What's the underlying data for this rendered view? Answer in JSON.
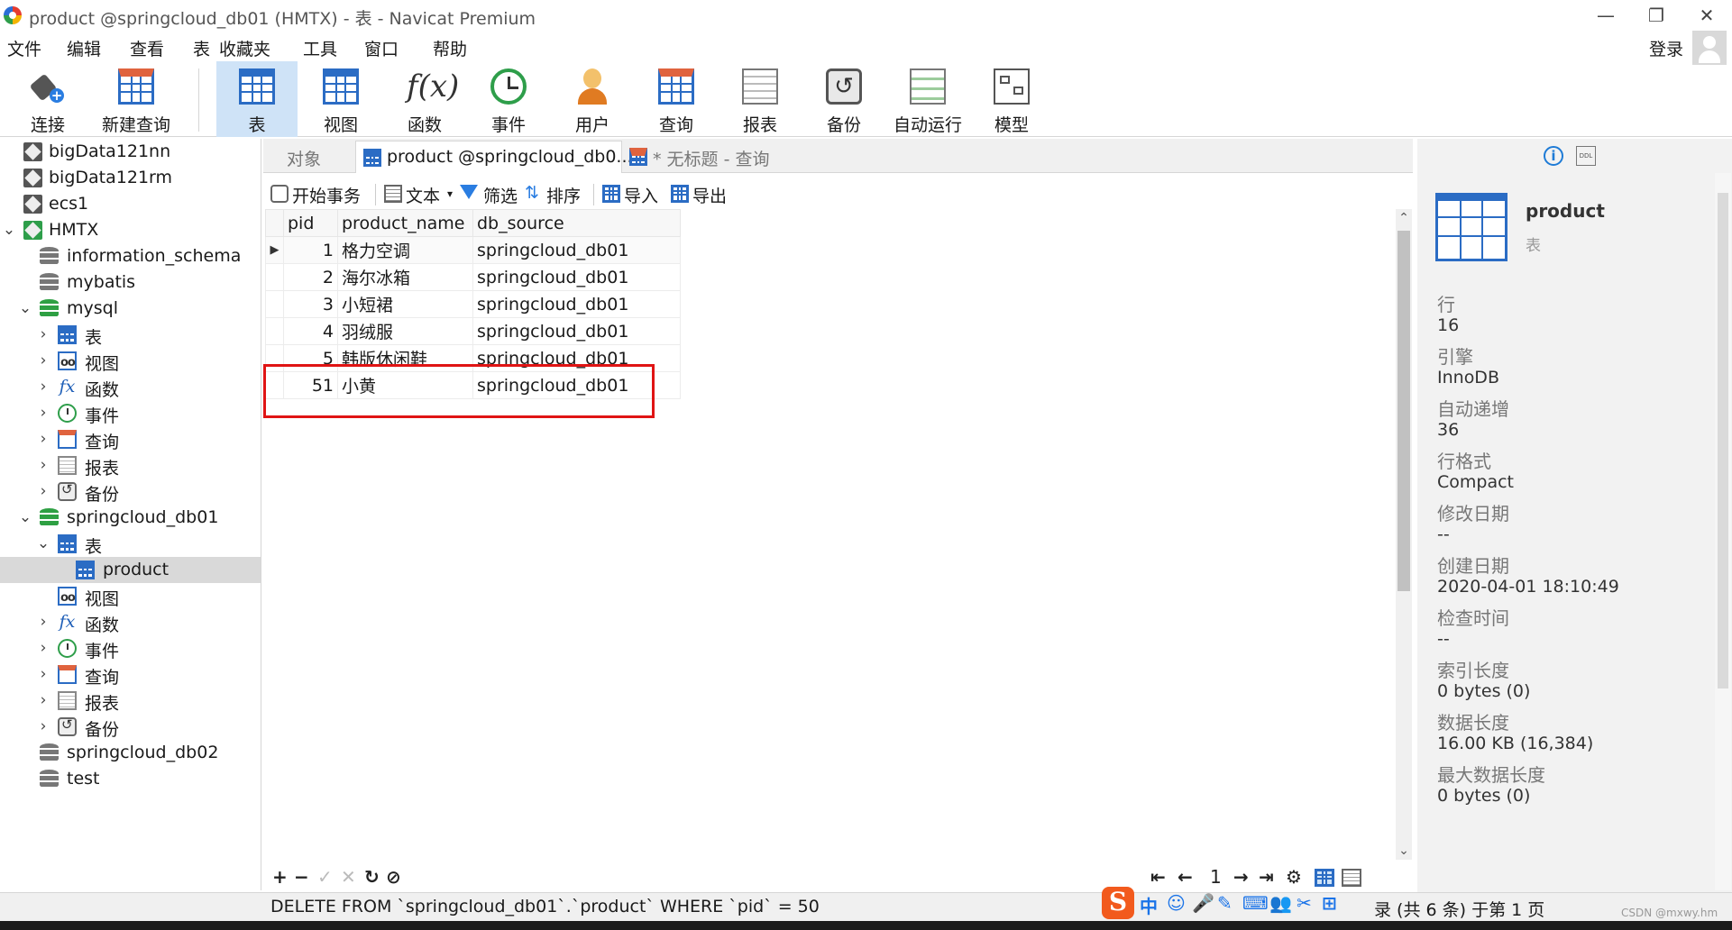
{
  "window": {
    "title": "product @springcloud_db01 (HMTX) - 表 - Navicat Premium",
    "controls": [
      "—",
      "❐",
      "✕"
    ]
  },
  "menu": [
    "文件",
    "编辑",
    "查看",
    "表",
    "收藏夹",
    "工具",
    "窗口",
    "帮助"
  ],
  "login_label": "登录",
  "toolbar": [
    {
      "label": "连接",
      "icon": "connect-icon"
    },
    {
      "label": "新建查询",
      "icon": "new-query-icon"
    },
    {
      "label": "表",
      "icon": "table-icon",
      "active": true
    },
    {
      "label": "视图",
      "icon": "view-icon"
    },
    {
      "label": "函数",
      "icon": "function-icon"
    },
    {
      "label": "事件",
      "icon": "event-icon"
    },
    {
      "label": "用户",
      "icon": "user-icon"
    },
    {
      "label": "查询",
      "icon": "query-icon"
    },
    {
      "label": "报表",
      "icon": "report-icon"
    },
    {
      "label": "备份",
      "icon": "backup-icon"
    },
    {
      "label": "自动运行",
      "icon": "automation-icon"
    },
    {
      "label": "模型",
      "icon": "model-icon"
    }
  ],
  "tree": [
    {
      "label": "bigData121nn",
      "level": 0,
      "icon": "connection"
    },
    {
      "label": "bigData121rm",
      "level": 0,
      "icon": "connection"
    },
    {
      "label": "ecs1",
      "level": 0,
      "icon": "connection"
    },
    {
      "label": "HMTX",
      "level": 0,
      "icon": "connection-open",
      "arrow": "down"
    },
    {
      "label": "information_schema",
      "level": 1,
      "icon": "database"
    },
    {
      "label": "mybatis",
      "level": 1,
      "icon": "database"
    },
    {
      "label": "mysql",
      "level": 1,
      "icon": "database-open",
      "arrow": "down"
    },
    {
      "label": "表",
      "level": 2,
      "icon": "table",
      "arrow": "right"
    },
    {
      "label": "视图",
      "level": 2,
      "icon": "view",
      "arrow": "right"
    },
    {
      "label": "函数",
      "level": 2,
      "icon": "function",
      "arrow": "right"
    },
    {
      "label": "事件",
      "level": 2,
      "icon": "event",
      "arrow": "right"
    },
    {
      "label": "查询",
      "level": 2,
      "icon": "query",
      "arrow": "right"
    },
    {
      "label": "报表",
      "level": 2,
      "icon": "report",
      "arrow": "right"
    },
    {
      "label": "备份",
      "level": 2,
      "icon": "backup",
      "arrow": "right"
    },
    {
      "label": "springcloud_db01",
      "level": 1,
      "icon": "database-open",
      "arrow": "down"
    },
    {
      "label": "表",
      "level": 2,
      "icon": "table",
      "arrow": "down"
    },
    {
      "label": "product",
      "level": 3,
      "icon": "table",
      "selected": true
    },
    {
      "label": "视图",
      "level": 2,
      "icon": "view"
    },
    {
      "label": "函数",
      "level": 2,
      "icon": "function",
      "arrow": "right"
    },
    {
      "label": "事件",
      "level": 2,
      "icon": "event",
      "arrow": "right"
    },
    {
      "label": "查询",
      "level": 2,
      "icon": "query",
      "arrow": "right"
    },
    {
      "label": "报表",
      "level": 2,
      "icon": "report",
      "arrow": "right"
    },
    {
      "label": "备份",
      "level": 2,
      "icon": "backup",
      "arrow": "right"
    },
    {
      "label": "springcloud_db02",
      "level": 1,
      "icon": "database"
    },
    {
      "label": "test",
      "level": 1,
      "icon": "database"
    }
  ],
  "tabs": [
    {
      "label": "对象",
      "active": false
    },
    {
      "label": "product @springcloud_db0...",
      "active": true,
      "icon": "table"
    },
    {
      "label": "* 无标题 - 查询",
      "active": false,
      "icon": "query"
    }
  ],
  "grid_toolbar": {
    "begin_transaction": "开始事务",
    "text": "文本",
    "filter": "筛选",
    "sort": "排序",
    "import": "导入",
    "export": "导出"
  },
  "grid": {
    "columns": [
      "pid",
      "product_name",
      "db_source"
    ],
    "rows": [
      [
        "1",
        "格力空调",
        "springcloud_db01"
      ],
      [
        "2",
        "海尔冰箱",
        "springcloud_db01"
      ],
      [
        "3",
        "小短裙",
        "springcloud_db01"
      ],
      [
        "4",
        "羽绒服",
        "springcloud_db01"
      ],
      [
        "5",
        "韩版休闲鞋",
        "springcloud_db01"
      ],
      [
        "51",
        "小黄",
        "springcloud_db01"
      ]
    ],
    "current_row_indicator": "▶"
  },
  "grid_nav": {
    "page": "1",
    "buttons": [
      "+",
      "−",
      "✓",
      "✕",
      "↻",
      "⊘"
    ],
    "pager": [
      "⇤",
      "←",
      "→",
      "⇥",
      "⚙"
    ]
  },
  "info": {
    "name": "product",
    "type": "表",
    "info_button": "i",
    "ddl_button": "DDL",
    "fields": [
      {
        "label": "行",
        "value": "16"
      },
      {
        "label": "引擎",
        "value": "InnoDB"
      },
      {
        "label": "自动递增",
        "value": "36"
      },
      {
        "label": "行格式",
        "value": "Compact"
      },
      {
        "label": "修改日期",
        "value": "--"
      },
      {
        "label": "创建日期",
        "value": "2020-04-01 18:10:49"
      },
      {
        "label": "检查时间",
        "value": "--"
      },
      {
        "label": "索引长度",
        "value": "0 bytes (0)"
      },
      {
        "label": "数据长度",
        "value": "16.00 KB (16,384)"
      },
      {
        "label": "最大数据长度",
        "value": "0 bytes (0)"
      }
    ]
  },
  "status": {
    "sql": "DELETE FROM `springcloud_db01`.`product` WHERE `pid` = 50",
    "records": "录 (共 6 条) 于第 1 页"
  },
  "ime": {
    "logo": "S",
    "glyphs": [
      "中",
      "☺",
      "🎤",
      "✎",
      "⌨",
      "👥",
      "✂",
      "⊞"
    ]
  },
  "watermark": "CSDN @mxwy.hm",
  "colors": {
    "accent": "#2b6cc4",
    "highlight": "#e01414",
    "active_toolbar": "#cfe3f7",
    "ime": "#f25a1d"
  }
}
